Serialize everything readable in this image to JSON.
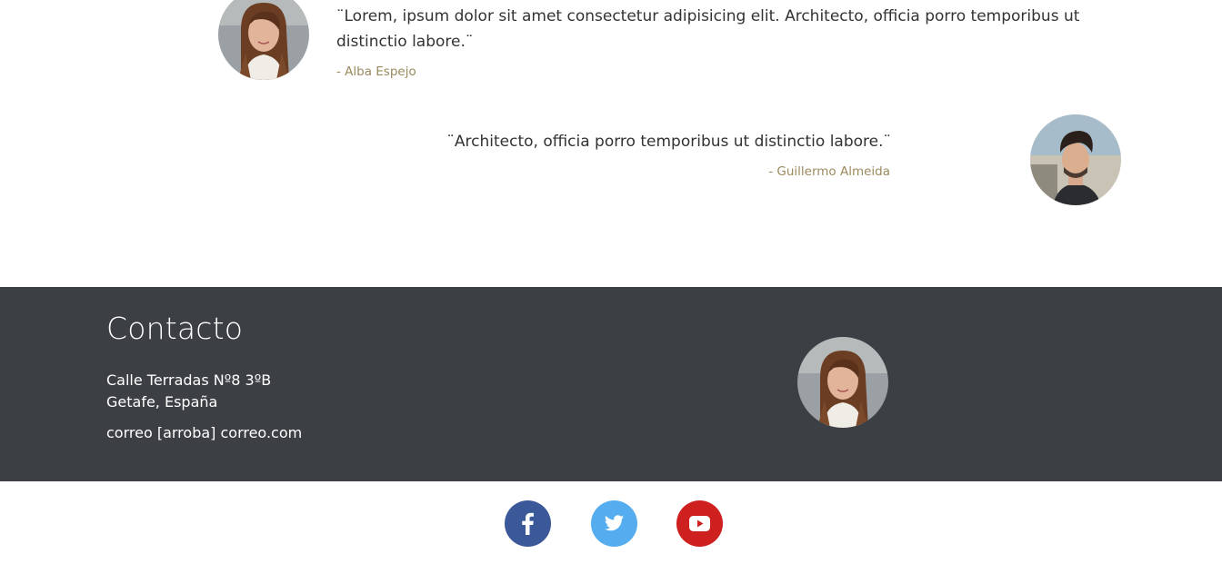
{
  "testimonials": [
    {
      "quote": "¨Lorem, ipsum dolor sit amet consectetur adipisicing elit. Architecto, officia porro temporibus ut distinctio labore.¨",
      "author": "- Alba Espejo",
      "avatar_icon": "woman-portrait"
    },
    {
      "quote": "¨Architecto, officia porro temporibus ut distinctio labore.¨",
      "author": "- Guillermo Almeida",
      "avatar_icon": "man-portrait"
    }
  ],
  "footer": {
    "title": "Contacto",
    "address_line1": "Calle Terradas Nº8 3ºB",
    "address_line2": "Getafe, España",
    "email": "correo [arroba] correo.com",
    "avatar_icon": "woman-portrait",
    "background": "#3c3f44"
  },
  "social": [
    {
      "icon": "facebook-icon",
      "color": "#3b5998"
    },
    {
      "icon": "twitter-icon",
      "color": "#55acee"
    },
    {
      "icon": "youtube-icon",
      "color": "#cd201f"
    }
  ],
  "colors": {
    "author": "#9a8a5e",
    "quote_text": "#333333"
  }
}
